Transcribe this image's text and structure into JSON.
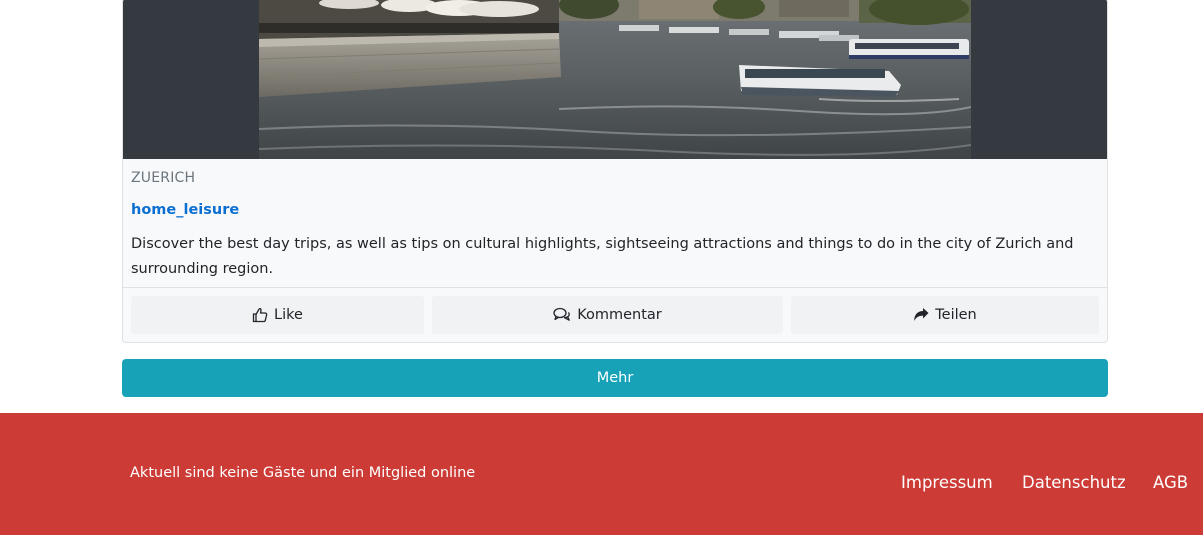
{
  "post": {
    "location": "ZUERICH",
    "author": "home_leisure",
    "description": "Discover the best day trips, as well as tips on cultural highlights, sightseeing attractions and things to do in the city of Zurich and surrounding region.",
    "actions": {
      "like_label": "Like",
      "comment_label": "Kommentar",
      "share_label": "Teilen"
    }
  },
  "more_button_label": "Mehr",
  "footer": {
    "online_status": "Aktuell sind keine Gäste und ein Mitglied online",
    "links": {
      "imprint": "Impressum",
      "privacy": "Datenschutz",
      "terms": "AGB"
    }
  },
  "colors": {
    "accent_button": "#17a2b8",
    "footer_background": "#cd3b36",
    "link": "#0b6fd1",
    "media_background": "#343a40"
  },
  "icons": {
    "like": "thumbs-up-icon",
    "comment": "comments-icon",
    "share": "share-arrow-icon"
  }
}
